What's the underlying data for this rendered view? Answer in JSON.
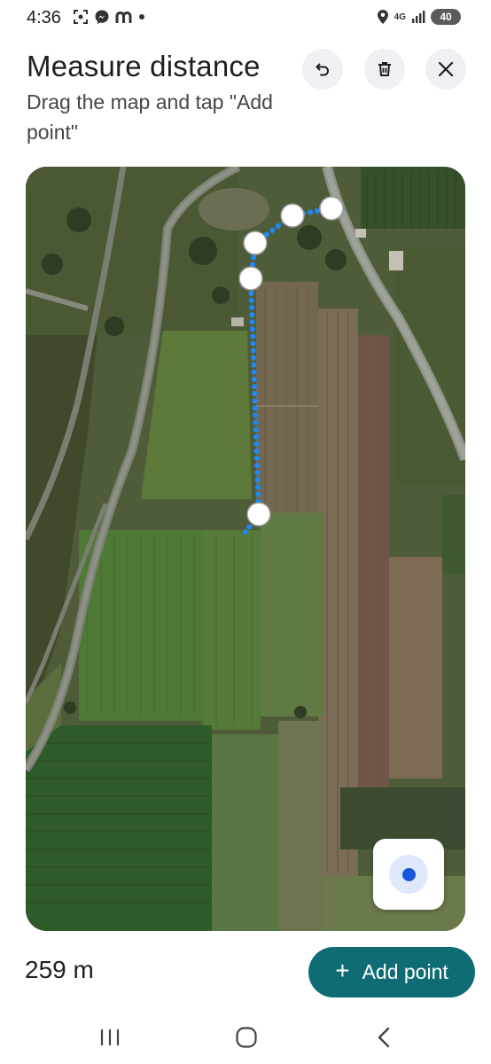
{
  "status_bar": {
    "time": "4:36",
    "left_icons": [
      "screenshot-icon",
      "messenger-icon",
      "m-app-icon",
      "dot-icon"
    ],
    "right_icons": [
      "location-icon",
      "4g-icon",
      "signal-icon"
    ],
    "network": "4G",
    "battery": "40"
  },
  "header": {
    "title": "Measure distance",
    "subtitle": "Drag the map and tap \"Add point\"",
    "undo_icon": "undo-icon",
    "delete_icon": "trash-icon",
    "close_icon": "close-icon"
  },
  "map": {
    "type": "satellite",
    "route_color": "#1e88f5",
    "point_count": 6,
    "locate_icon": "my-location-icon"
  },
  "bottom": {
    "distance": "259 m",
    "add_point_label": "Add point",
    "add_icon": "plus-icon",
    "button_color": "#0f6c74"
  },
  "nav_bar": {
    "icons": [
      "recents-icon",
      "home-icon",
      "back-icon"
    ]
  }
}
